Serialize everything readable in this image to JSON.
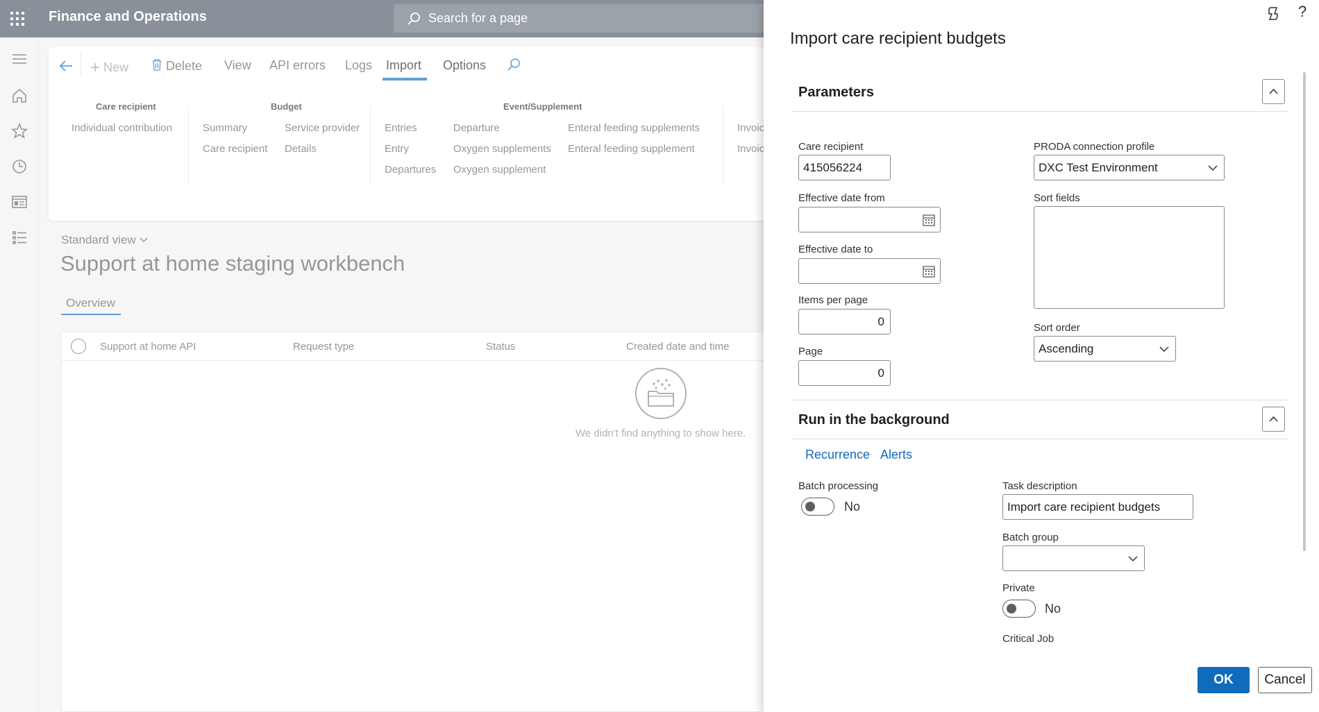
{
  "app": {
    "title": "Finance and Operations"
  },
  "search": {
    "placeholder": "Search for a page"
  },
  "toolbar": {
    "new": "New",
    "delete": "Delete",
    "view": "View",
    "api_errors": "API errors",
    "logs": "Logs",
    "import": "Import",
    "options": "Options"
  },
  "ribbon": {
    "care_recipient": {
      "header": "Care recipient",
      "items": [
        "Individual contribution"
      ]
    },
    "budget": {
      "header": "Budget",
      "col1": [
        "Summary",
        "Care recipient"
      ],
      "col2": [
        "Service provider",
        "Details"
      ]
    },
    "event": {
      "header": "Event/Supplement",
      "col1": [
        "Entries",
        "Entry",
        "Departures"
      ],
      "col2": [
        "Departure",
        "Oxygen supplements",
        "Oxygen supplement"
      ],
      "col3": [
        "Enteral feeding supplements",
        "Enteral feeding supplement"
      ]
    },
    "invoice": {
      "items": [
        "Invoic",
        "Invoic"
      ]
    }
  },
  "page": {
    "view_selector": "Standard view",
    "title": "Support at home staging workbench",
    "tab": "Overview",
    "columns": [
      "Support at home API",
      "Request type",
      "Status",
      "Created date and time"
    ],
    "empty_text": "We didn't find anything to show here."
  },
  "dialog": {
    "title": "Import care recipient budgets",
    "parameters": {
      "header": "Parameters",
      "care_recipient_label": "Care recipient",
      "care_recipient_value": "415056224",
      "effective_from_label": "Effective date from",
      "effective_from_value": "",
      "effective_to_label": "Effective date to",
      "effective_to_value": "",
      "items_per_page_label": "Items per page",
      "items_per_page_value": "0",
      "page_label": "Page",
      "page_value": "0",
      "proda_label": "PRODA connection profile",
      "proda_value": "DXC Test Environment",
      "sort_fields_label": "Sort fields",
      "sort_order_label": "Sort order",
      "sort_order_value": "Ascending"
    },
    "background": {
      "header": "Run in the background",
      "recurrence": "Recurrence",
      "alerts": "Alerts",
      "batch_processing_label": "Batch processing",
      "batch_processing_value": "No",
      "task_description_label": "Task description",
      "task_description_value": "Import care recipient budgets",
      "batch_group_label": "Batch group",
      "batch_group_value": "",
      "private_label": "Private",
      "private_value": "No",
      "critical_job_label": "Critical Job"
    },
    "ok": "OK",
    "cancel": "Cancel"
  },
  "colors": {
    "topbar": "#4a5563",
    "accent": "#0f6cbd"
  }
}
